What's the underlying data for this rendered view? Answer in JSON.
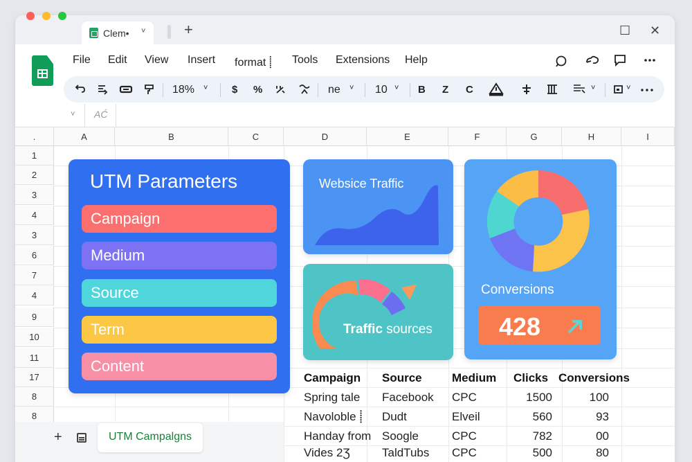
{
  "browser": {
    "tab_title": "Clem•",
    "tab_chevron": "˅",
    "new_tab": "+",
    "maximize": "☐",
    "close": "✕"
  },
  "menu": [
    "File",
    "Edit",
    "View",
    "Insert",
    "format ⸽",
    "Tools",
    "Extensions",
    "Help"
  ],
  "toolbar": {
    "zoom": "18%",
    "currency": "$",
    "percent": "%",
    "font": "ne",
    "font_size": "10",
    "bold": "B",
    "italic": "Z",
    "strike": "C"
  },
  "formula_bar": {
    "fx": "AĆ"
  },
  "columns": [
    ".",
    "A",
    "B",
    "C",
    "D",
    "E",
    "F",
    "G",
    "H",
    "I"
  ],
  "rows": [
    "1",
    "2",
    "3",
    "4",
    "3",
    "6",
    "7",
    "4",
    "9",
    "10",
    "11",
    "17",
    "8",
    "8"
  ],
  "utm_card": {
    "title": "UTM Parameters",
    "items": [
      {
        "label": "Campaign",
        "color": "#fb6f6f"
      },
      {
        "label": "Medium",
        "color": "#7c72f3"
      },
      {
        "label": "Source",
        "color": "#4fd6dd"
      },
      {
        "label": "Term",
        "color": "#fbc745"
      },
      {
        "label": "Content",
        "color": "#f78fa7"
      }
    ]
  },
  "traffic_card": {
    "title": "Websice Traffic"
  },
  "sources_card": {
    "title_bold": "Traffic",
    "title_rest": " sources"
  },
  "conversions_card": {
    "label": "Conversions",
    "value": "428"
  },
  "table": {
    "headers": [
      "Campaign",
      "Source",
      "Medium",
      "Clicks",
      "Conversions"
    ],
    "rows": [
      [
        "Spring tale",
        "Facebook",
        "CPC",
        "1500",
        "100"
      ],
      [
        "Navoloble ⸽",
        "Dudt",
        "Elveil",
        "560",
        "93"
      ],
      [
        "Handay from",
        "Soogle",
        "CPC",
        "782",
        "00"
      ],
      [
        "Vides 2Ʒ",
        "TaldTubs",
        "CPC",
        "500",
        "80"
      ]
    ]
  },
  "sheet_tab": {
    "label": "UTM Campalgns"
  },
  "colors": {
    "accent_green": "#188038",
    "utm_card": "#2f6ff0",
    "traffic_card": "#4b94f3",
    "sources_card": "#4fc4c6",
    "conversions_card": "#56a4f6",
    "conversions_badge": "#f97c4f"
  }
}
